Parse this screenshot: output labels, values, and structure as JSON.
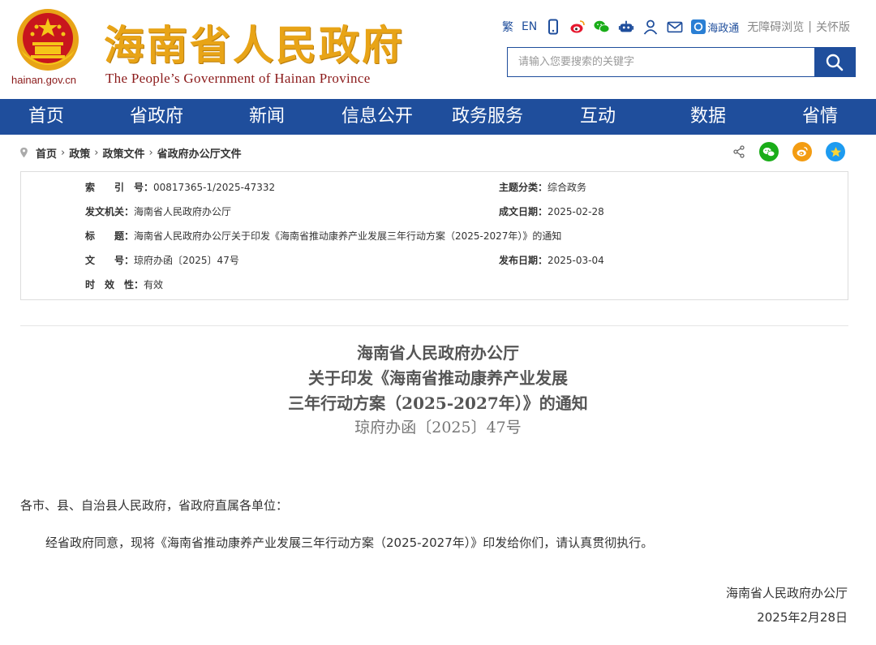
{
  "header": {
    "domain": "hainan.gov.cn",
    "site_title": "海南省人民政府",
    "site_subtitle": "The People’s Government  of Hainan Province",
    "toolbar": {
      "traditional": "繁",
      "english": "EN",
      "app_icon": "mobile-icon",
      "weibo_icon": "weibo-icon",
      "wechat_icon": "wechat-icon",
      "robot_icon": "robot-icon",
      "user_icon": "user-icon",
      "mail_icon": "mail-icon",
      "haizhengtong": "海政通",
      "accessible": "无障碍浏览",
      "separator": "|",
      "care": "关怀版"
    },
    "search": {
      "placeholder": "请输入您要搜索的关键字"
    }
  },
  "nav": [
    "首页",
    "省政府",
    "新闻",
    "信息公开",
    "政务服务",
    "互动",
    "数据",
    "省情"
  ],
  "breadcrumb": [
    "首页",
    "政策",
    "政策文件",
    "省政府办公厅文件"
  ],
  "share": {
    "share_icon": "share-icon",
    "wechat": "wechat-icon",
    "weibo": "weibo-icon",
    "qzone": "qzone-icon"
  },
  "info": {
    "index_label": "索　　引　号：",
    "index_value": "00817365-1/2025-47332",
    "category_label": "主题分类：",
    "category_value": "综合政务",
    "issuer_label": "发文机关：",
    "issuer_value": "海南省人民政府办公厅",
    "date_made_label": "成文日期：",
    "date_made_value": "2025-02-28",
    "title_label": "标　　题：",
    "title_value": "海南省人民政府办公厅关于印发《海南省推动康养产业发展三年行动方案（2025-2027年）》的通知",
    "docno_label": "文　　号：",
    "docno_value": "琼府办函〔2025〕47号",
    "pub_date_label": "发布日期：",
    "pub_date_value": "2025-03-04",
    "validity_label": "时　效　性：",
    "validity_value": "有效"
  },
  "doc": {
    "title_line1": "海南省人民政府办公厅",
    "title_line2": "关于印发《海南省推动康养产业发展",
    "title_line3": "三年行动方案（2025-2027年）》的通知",
    "doc_number": "琼府办函〔2025〕47号",
    "salutation": "各市、县、自治县人民政府，省政府直属各单位：",
    "paragraph1": "经省政府同意，现将《海南省推动康养产业发展三年行动方案（2025-2027年）》印发给你们，请认真贯彻执行。",
    "signature": "海南省人民政府办公厅",
    "sign_date": "2025年2月28日"
  },
  "colors": {
    "nav_blue": "#1f4e9c",
    "title_gold": "#e8a417",
    "emblem_red": "#c8161d",
    "wechat_green": "#1aad19",
    "weibo_orange": "#f39c12",
    "qzone_blue": "#1d9bf0"
  }
}
